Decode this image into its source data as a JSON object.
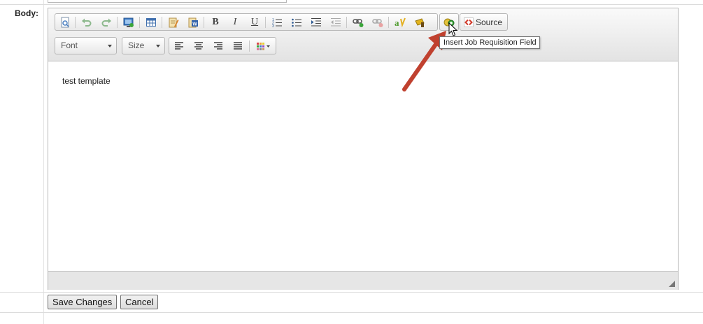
{
  "form": {
    "body_label": "Body:"
  },
  "editor": {
    "content_text": "test template",
    "toolbar": {
      "source_label": "Source",
      "font_label": "Font",
      "size_label": "Size",
      "tooltip_text": "Insert Job Requisition Field"
    }
  },
  "actions": {
    "save_label": "Save Changes",
    "cancel_label": "Cancel"
  },
  "colors": {
    "annotation_arrow": "#c0412f"
  }
}
